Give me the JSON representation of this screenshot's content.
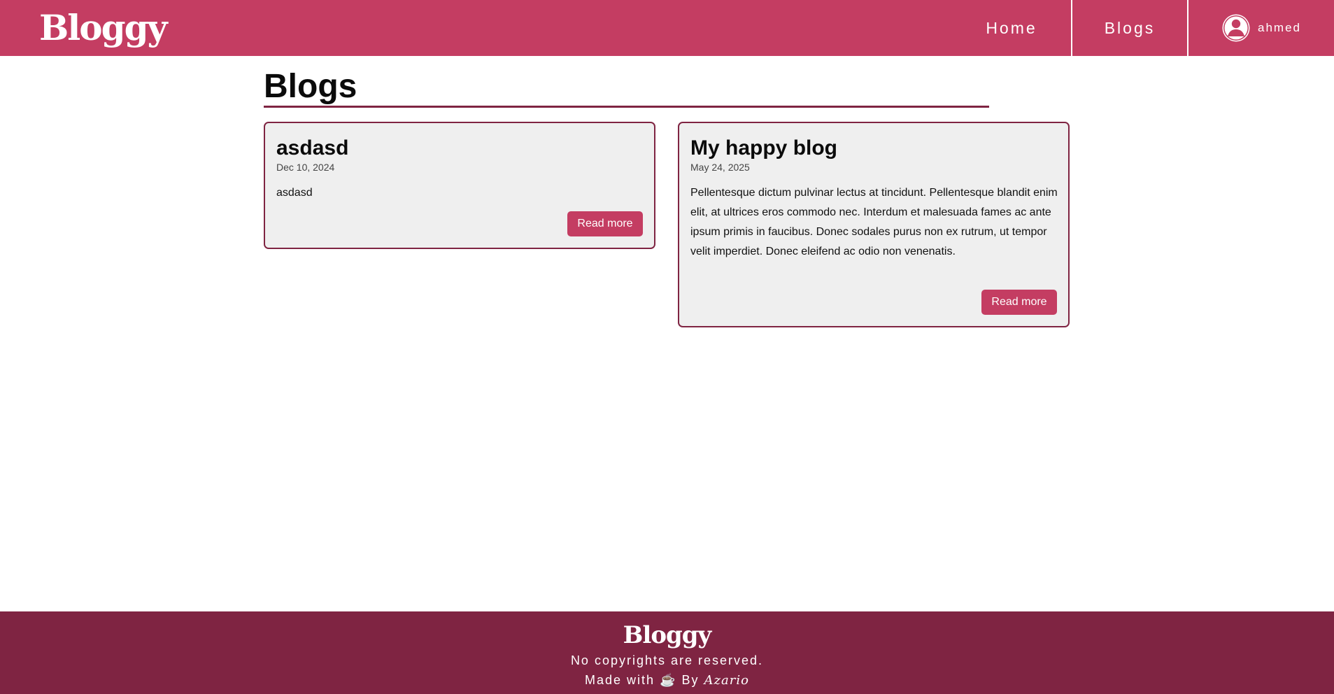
{
  "colors": {
    "brand": "#c43d62",
    "footer": "#7f2442",
    "card_bg": "#efefef",
    "text": "#0b0b0b"
  },
  "navbar": {
    "brand": "Bloggy",
    "links": [
      {
        "label": "Home"
      },
      {
        "label": "Blogs"
      }
    ],
    "user": {
      "name": "ahmed",
      "icon": "user-avatar-icon"
    }
  },
  "main": {
    "title": "Blogs",
    "posts": [
      {
        "title": "asdasd",
        "date": "Dec 10, 2024",
        "excerpt": "asdasd",
        "button": "Read more"
      },
      {
        "title": "My happy blog",
        "date": "May 24, 2025",
        "excerpt": "Pellentesque dictum pulvinar lectus at tincidunt. Pellentesque blandit enim elit, at ultrices eros commodo nec. Interdum et malesuada fames ac ante ipsum primis in faucibus. Donec sodales purus non ex rutrum, ut tempor velit imperdiet. Donec eleifend ac odio non venenatis.",
        "button": "Read more"
      }
    ]
  },
  "footer": {
    "brand": "Bloggy",
    "line1": "No copyrights are reserved.",
    "made_with": "Made with",
    "coffee": "☕",
    "by": "By",
    "author": "Azario"
  }
}
